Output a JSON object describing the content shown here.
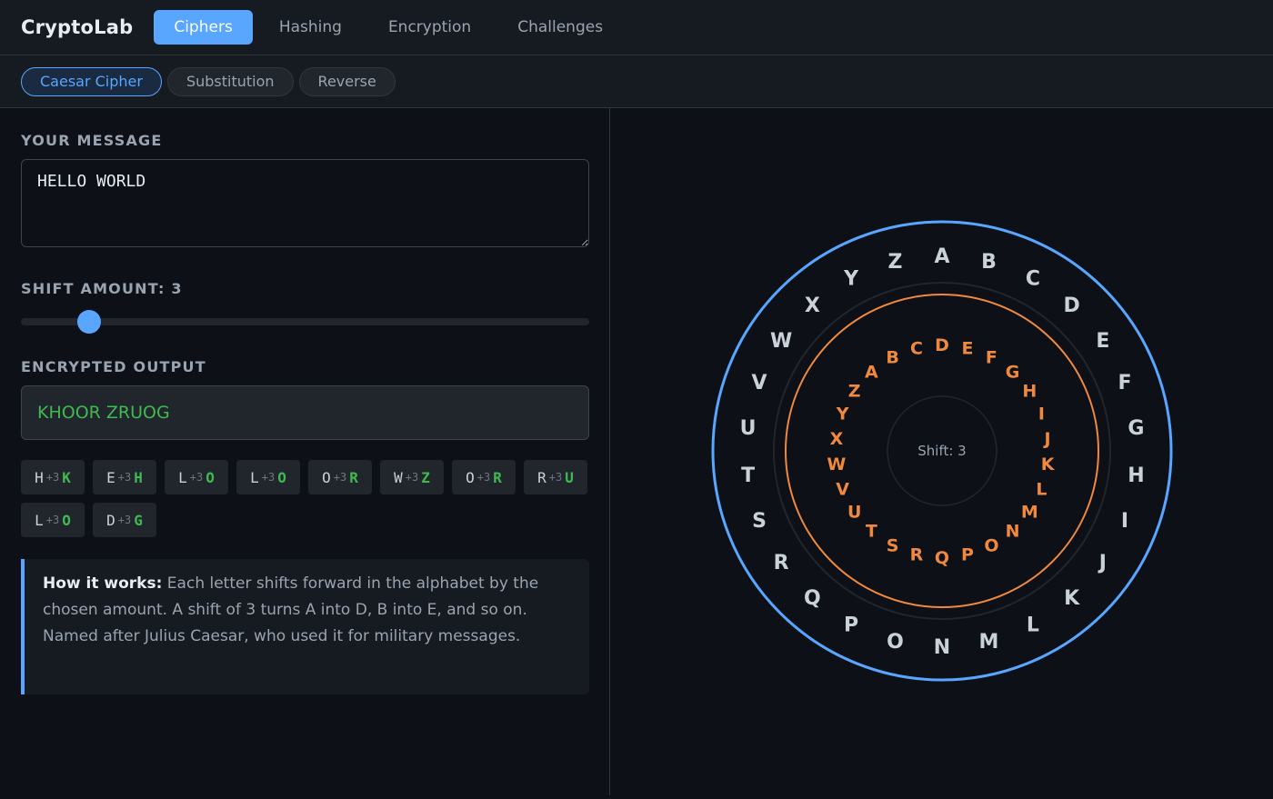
{
  "app": {
    "brand": "CryptoLab",
    "nav_tabs": [
      {
        "label": "Ciphers",
        "active": true
      },
      {
        "label": "Hashing",
        "active": false
      },
      {
        "label": "Encryption",
        "active": false
      },
      {
        "label": "Challenges",
        "active": false
      }
    ],
    "sub_tabs": [
      {
        "label": "Caesar Cipher",
        "active": true
      },
      {
        "label": "Substitution",
        "active": false
      },
      {
        "label": "Reverse",
        "active": false
      }
    ]
  },
  "cipher": {
    "message_label": "YOUR MESSAGE",
    "message_value": "HELLO WORLD",
    "shift_label_prefix": "SHIFT AMOUNT: ",
    "shift_value": 3,
    "shift_min": 0,
    "shift_max": 25,
    "output_label": "ENCRYPTED OUTPUT",
    "output_value": "KHOOR ZRUOG",
    "shift_tag": "+3",
    "mappings": [
      {
        "src": "H",
        "dst": "K"
      },
      {
        "src": "E",
        "dst": "H"
      },
      {
        "src": "L",
        "dst": "O"
      },
      {
        "src": "L",
        "dst": "O"
      },
      {
        "src": "O",
        "dst": "R"
      },
      {
        "src": "W",
        "dst": "Z"
      },
      {
        "src": "O",
        "dst": "R"
      },
      {
        "src": "R",
        "dst": "U"
      },
      {
        "src": "L",
        "dst": "O"
      },
      {
        "src": "D",
        "dst": "G"
      }
    ],
    "info_title": "How it works:",
    "info_text": " Each letter shifts forward in the alphabet by the chosen amount. A shift of 3 turns A into D, B into E, and so on. Named after Julius Caesar, who used it for military messages."
  },
  "wheel": {
    "outer_letters": [
      "A",
      "B",
      "C",
      "D",
      "E",
      "F",
      "G",
      "H",
      "I",
      "J",
      "K",
      "L",
      "M",
      "N",
      "O",
      "P",
      "Q",
      "R",
      "S",
      "T",
      "U",
      "V",
      "W",
      "X",
      "Y",
      "Z"
    ],
    "inner_letters": [
      "A",
      "B",
      "C",
      "D",
      "E",
      "F",
      "G",
      "H",
      "I",
      "J",
      "K",
      "L",
      "M",
      "N",
      "O",
      "P",
      "Q",
      "R",
      "S",
      "T",
      "U",
      "V",
      "W",
      "X",
      "Y",
      "Z"
    ],
    "center_label": "Shift: 3",
    "outer_color": "#58a6ff",
    "inner_color": "#f0883e"
  },
  "colors": {
    "accent": "#58a6ff",
    "success": "#3fb950",
    "inner_ring": "#f0883e"
  }
}
